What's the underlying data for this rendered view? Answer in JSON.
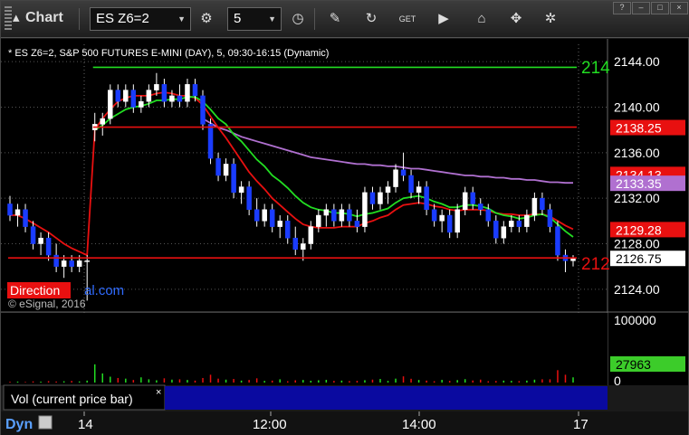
{
  "window": {
    "title": "Chart",
    "controls": [
      "?",
      "–",
      "□",
      "×"
    ]
  },
  "toolbar": {
    "symbol": "ES Z6=2",
    "interval": "5",
    "icons": [
      "gear-icon",
      "clock-icon",
      "pencil-icon",
      "refresh-icon",
      "get-icon",
      "play-icon",
      "tag-icon",
      "link-icon",
      "settings-icon"
    ]
  },
  "chart": {
    "header": "* ES Z6=2, S&P 500 FUTURES E-MINI (DAY), 5, 09:30-16:15 (Dynamic)",
    "watermark": "© eSignal, 2016",
    "direction_label": "Direction",
    "direction_suffix": "al.com",
    "hline_label_1": "214",
    "hline_label_2": "212",
    "price_ticks": [
      "2144.00",
      "2140.00",
      "2136.00",
      "2132.00",
      "2128.00",
      "2124.00"
    ],
    "price_badges": [
      {
        "text": "2138.25",
        "bg": "#e81010",
        "fg": "#fff"
      },
      {
        "text": "2134.13",
        "bg": "#e81010",
        "fg": "#fff"
      },
      {
        "text": "2133.35",
        "bg": "#b070d0",
        "fg": "#fff"
      },
      {
        "text": "2129.28",
        "bg": "#e81010",
        "fg": "#fff"
      },
      {
        "text": "2126.75",
        "bg": "#fff",
        "fg": "#000"
      }
    ]
  },
  "volume": {
    "label": "Vol (current price bar)",
    "close_label": "×",
    "ticks": [
      "100000",
      "0"
    ],
    "badge": "27963",
    "badge_color": "#3ccc2a"
  },
  "time_axis": {
    "labels": [
      "14",
      "12:00",
      "14:00",
      "17"
    ],
    "dyn": "Dyn",
    "footer_icon": "lock-icon"
  },
  "chart_data": {
    "type": "candlestick",
    "title": "* ES Z6=2, S&P 500 FUTURES E-MINI (DAY), 5, 09:30-16:15 (Dynamic)",
    "y_range": [
      2122.0,
      2146.0
    ],
    "candles": [
      {
        "o": 2131.5,
        "h": 2132.2,
        "l": 2130.0,
        "c": 2130.5
      },
      {
        "o": 2130.5,
        "h": 2131.5,
        "l": 2129.5,
        "c": 2131.0
      },
      {
        "o": 2131.0,
        "h": 2131.5,
        "l": 2129.0,
        "c": 2129.5
      },
      {
        "o": 2129.5,
        "h": 2130.0,
        "l": 2127.5,
        "c": 2128.0
      },
      {
        "o": 2128.0,
        "h": 2129.0,
        "l": 2127.0,
        "c": 2128.5
      },
      {
        "o": 2128.5,
        "h": 2129.0,
        "l": 2126.5,
        "c": 2127.0
      },
      {
        "o": 2127.0,
        "h": 2128.0,
        "l": 2125.5,
        "c": 2126.0
      },
      {
        "o": 2126.0,
        "h": 2127.0,
        "l": 2125.0,
        "c": 2126.5
      },
      {
        "o": 2126.5,
        "h": 2127.0,
        "l": 2125.5,
        "c": 2126.0
      },
      {
        "o": 2126.0,
        "h": 2127.0,
        "l": 2125.5,
        "c": 2126.5
      },
      {
        "o": 2126.5,
        "h": 2127.0,
        "l": 2123.0,
        "c": 2126.5
      },
      {
        "o": 2138.0,
        "h": 2139.5,
        "l": 2137.0,
        "c": 2138.5
      },
      {
        "o": 2138.5,
        "h": 2139.5,
        "l": 2137.5,
        "c": 2139.0
      },
      {
        "o": 2139.0,
        "h": 2142.0,
        "l": 2138.5,
        "c": 2141.5
      },
      {
        "o": 2141.5,
        "h": 2142.0,
        "l": 2140.0,
        "c": 2140.5
      },
      {
        "o": 2140.5,
        "h": 2142.0,
        "l": 2140.0,
        "c": 2141.5
      },
      {
        "o": 2141.5,
        "h": 2142.0,
        "l": 2139.5,
        "c": 2140.0
      },
      {
        "o": 2140.0,
        "h": 2141.0,
        "l": 2139.5,
        "c": 2140.5
      },
      {
        "o": 2140.5,
        "h": 2142.0,
        "l": 2140.0,
        "c": 2141.5
      },
      {
        "o": 2141.5,
        "h": 2143.0,
        "l": 2141.0,
        "c": 2142.0
      },
      {
        "o": 2142.0,
        "h": 2142.5,
        "l": 2140.0,
        "c": 2140.5
      },
      {
        "o": 2140.5,
        "h": 2141.5,
        "l": 2140.0,
        "c": 2141.0
      },
      {
        "o": 2141.0,
        "h": 2142.0,
        "l": 2140.0,
        "c": 2140.5
      },
      {
        "o": 2140.5,
        "h": 2142.5,
        "l": 2140.0,
        "c": 2142.0
      },
      {
        "o": 2142.0,
        "h": 2142.5,
        "l": 2140.5,
        "c": 2141.0
      },
      {
        "o": 2141.0,
        "h": 2141.5,
        "l": 2138.0,
        "c": 2138.5
      },
      {
        "o": 2138.5,
        "h": 2139.0,
        "l": 2135.0,
        "c": 2135.5
      },
      {
        "o": 2135.5,
        "h": 2136.0,
        "l": 2133.5,
        "c": 2134.0
      },
      {
        "o": 2134.0,
        "h": 2135.5,
        "l": 2133.5,
        "c": 2135.0
      },
      {
        "o": 2135.0,
        "h": 2135.5,
        "l": 2132.0,
        "c": 2132.5
      },
      {
        "o": 2132.5,
        "h": 2133.5,
        "l": 2131.5,
        "c": 2133.0
      },
      {
        "o": 2133.0,
        "h": 2133.5,
        "l": 2130.5,
        "c": 2131.0
      },
      {
        "o": 2131.0,
        "h": 2132.0,
        "l": 2129.5,
        "c": 2130.0
      },
      {
        "o": 2130.0,
        "h": 2131.5,
        "l": 2129.5,
        "c": 2131.0
      },
      {
        "o": 2131.0,
        "h": 2131.5,
        "l": 2129.0,
        "c": 2129.5
      },
      {
        "o": 2129.5,
        "h": 2130.5,
        "l": 2128.5,
        "c": 2130.0
      },
      {
        "o": 2130.0,
        "h": 2130.5,
        "l": 2128.0,
        "c": 2128.5
      },
      {
        "o": 2128.5,
        "h": 2129.5,
        "l": 2127.0,
        "c": 2127.5
      },
      {
        "o": 2127.5,
        "h": 2128.5,
        "l": 2126.5,
        "c": 2128.0
      },
      {
        "o": 2128.0,
        "h": 2130.0,
        "l": 2127.5,
        "c": 2129.5
      },
      {
        "o": 2129.5,
        "h": 2131.0,
        "l": 2129.0,
        "c": 2130.5
      },
      {
        "o": 2130.5,
        "h": 2131.5,
        "l": 2129.5,
        "c": 2131.0
      },
      {
        "o": 2131.0,
        "h": 2131.5,
        "l": 2129.5,
        "c": 2130.0
      },
      {
        "o": 2130.0,
        "h": 2131.5,
        "l": 2129.5,
        "c": 2131.0
      },
      {
        "o": 2131.0,
        "h": 2131.5,
        "l": 2129.5,
        "c": 2130.0
      },
      {
        "o": 2130.0,
        "h": 2131.0,
        "l": 2129.0,
        "c": 2129.5
      },
      {
        "o": 2129.5,
        "h": 2133.0,
        "l": 2129.0,
        "c": 2132.5
      },
      {
        "o": 2132.5,
        "h": 2133.0,
        "l": 2131.0,
        "c": 2131.5
      },
      {
        "o": 2131.5,
        "h": 2133.0,
        "l": 2131.0,
        "c": 2132.5
      },
      {
        "o": 2132.5,
        "h": 2133.5,
        "l": 2131.5,
        "c": 2133.0
      },
      {
        "o": 2133.0,
        "h": 2135.0,
        "l": 2132.5,
        "c": 2134.5
      },
      {
        "o": 2134.5,
        "h": 2136.0,
        "l": 2133.5,
        "c": 2134.0
      },
      {
        "o": 2134.0,
        "h": 2134.5,
        "l": 2132.0,
        "c": 2132.5
      },
      {
        "o": 2132.5,
        "h": 2133.5,
        "l": 2131.5,
        "c": 2133.0
      },
      {
        "o": 2133.0,
        "h": 2133.5,
        "l": 2130.5,
        "c": 2131.0
      },
      {
        "o": 2131.0,
        "h": 2131.5,
        "l": 2129.5,
        "c": 2130.0
      },
      {
        "o": 2130.0,
        "h": 2131.0,
        "l": 2129.0,
        "c": 2130.5
      },
      {
        "o": 2130.5,
        "h": 2131.0,
        "l": 2128.5,
        "c": 2129.0
      },
      {
        "o": 2129.0,
        "h": 2131.5,
        "l": 2128.5,
        "c": 2131.0
      },
      {
        "o": 2131.0,
        "h": 2133.0,
        "l": 2130.5,
        "c": 2132.5
      },
      {
        "o": 2132.5,
        "h": 2133.0,
        "l": 2131.0,
        "c": 2131.5
      },
      {
        "o": 2131.5,
        "h": 2132.0,
        "l": 2130.5,
        "c": 2131.0
      },
      {
        "o": 2131.0,
        "h": 2131.5,
        "l": 2129.5,
        "c": 2130.0
      },
      {
        "o": 2130.0,
        "h": 2130.5,
        "l": 2128.0,
        "c": 2128.5
      },
      {
        "o": 2128.5,
        "h": 2130.0,
        "l": 2128.0,
        "c": 2129.5
      },
      {
        "o": 2129.5,
        "h": 2130.5,
        "l": 2129.0,
        "c": 2130.0
      },
      {
        "o": 2130.0,
        "h": 2130.5,
        "l": 2129.0,
        "c": 2129.5
      },
      {
        "o": 2129.5,
        "h": 2131.0,
        "l": 2129.0,
        "c": 2130.5
      },
      {
        "o": 2130.5,
        "h": 2132.5,
        "l": 2130.0,
        "c": 2132.0
      },
      {
        "o": 2132.0,
        "h": 2132.5,
        "l": 2130.5,
        "c": 2131.0
      },
      {
        "o": 2131.0,
        "h": 2131.5,
        "l": 2129.0,
        "c": 2129.5
      },
      {
        "o": 2129.5,
        "h": 2130.0,
        "l": 2126.5,
        "c": 2127.0
      },
      {
        "o": 2127.0,
        "h": 2127.5,
        "l": 2125.5,
        "c": 2126.5
      },
      {
        "o": 2126.5,
        "h": 2127.0,
        "l": 2126.0,
        "c": 2126.75
      }
    ],
    "ema_red": [
      2130.5,
      2130.5,
      2130.2,
      2129.8,
      2129.4,
      2129.0,
      2128.5,
      2128.0,
      2127.6,
      2127.3,
      2127.0,
      2138.0,
      2139.0,
      2139.8,
      2140.5,
      2140.8,
      2141.0,
      2141.0,
      2141.0,
      2141.2,
      2141.3,
      2141.2,
      2141.0,
      2141.0,
      2140.8,
      2140.2,
      2139.2,
      2138.2,
      2137.3,
      2136.3,
      2135.3,
      2134.3,
      2133.5,
      2132.8,
      2132.0,
      2131.4,
      2130.8,
      2130.2,
      2129.7,
      2129.5,
      2129.4,
      2129.4,
      2129.4,
      2129.5,
      2129.5,
      2129.5,
      2129.8,
      2130.0,
      2130.3,
      2130.5,
      2131.0,
      2131.4,
      2131.5,
      2131.6,
      2131.5,
      2131.3,
      2131.2,
      2131.0,
      2130.9,
      2131.0,
      2131.0,
      2131.0,
      2130.9,
      2130.7,
      2130.6,
      2130.6,
      2130.5,
      2130.5,
      2130.6,
      2130.6,
      2130.4,
      2130.0,
      2129.6,
      2129.28
    ],
    "ema_green": [
      null,
      null,
      null,
      null,
      null,
      null,
      null,
      null,
      null,
      null,
      null,
      2138.0,
      2138.4,
      2139.0,
      2139.4,
      2139.8,
      2140.0,
      2140.1,
      2140.3,
      2140.6,
      2140.6,
      2140.7,
      2140.7,
      2140.9,
      2140.9,
      2140.5,
      2139.8,
      2139.0,
      2138.5,
      2137.6,
      2137.0,
      2136.2,
      2135.4,
      2134.8,
      2134.0,
      2133.5,
      2132.9,
      2132.2,
      2131.6,
      2131.2,
      2131.0,
      2130.9,
      2130.7,
      2130.7,
      2130.6,
      2130.4,
      2130.6,
      2130.7,
      2130.9,
      2131.1,
      2131.6,
      2132.0,
      2132.1,
      2132.2,
      2132.0,
      2131.7,
      2131.5,
      2131.2,
      2131.2,
      2131.4,
      2131.4,
      2131.3,
      2131.1,
      2130.7,
      2130.5,
      2130.4,
      2130.2,
      2130.3,
      2130.5,
      2130.6,
      2130.3,
      2129.7,
      2129.1,
      2128.6
    ],
    "vwap_purple": [
      null,
      null,
      null,
      null,
      null,
      null,
      null,
      null,
      null,
      null,
      null,
      null,
      null,
      null,
      null,
      null,
      null,
      null,
      null,
      null,
      null,
      null,
      null,
      null,
      null,
      2139.0,
      2138.6,
      2138.2,
      2138.0,
      2137.7,
      2137.4,
      2137.2,
      2137.0,
      2136.8,
      2136.6,
      2136.4,
      2136.2,
      2136.0,
      2135.8,
      2135.6,
      2135.5,
      2135.4,
      2135.3,
      2135.2,
      2135.1,
      2135.0,
      2135.0,
      2134.9,
      2134.9,
      2134.8,
      2134.8,
      2134.7,
      2134.6,
      2134.6,
      2134.5,
      2134.4,
      2134.3,
      2134.2,
      2134.1,
      2134.0,
      2134.0,
      2133.9,
      2133.9,
      2133.8,
      2133.8,
      2133.7,
      2133.7,
      2133.6,
      2133.6,
      2133.5,
      2133.4,
      2133.4,
      2133.35,
      2133.35
    ],
    "hlines": [
      {
        "value": 2143.5,
        "color": "#22dd22",
        "from": 11
      },
      {
        "value": 2138.25,
        "color": "#e81010",
        "from": 11
      },
      {
        "value": 2126.75,
        "color": "#e81010",
        "from": 0
      }
    ],
    "volume": [
      1200,
      1500,
      900,
      1800,
      1400,
      2200,
      1600,
      2000,
      2500,
      1700,
      3000,
      28000,
      14000,
      9000,
      7000,
      6000,
      4000,
      8000,
      5000,
      3500,
      6500,
      4500,
      5000,
      4000,
      3000,
      7000,
      12000,
      6000,
      4500,
      5500,
      3000,
      4000,
      6500,
      2500,
      3000,
      5000,
      2000,
      3500,
      4000,
      2800,
      3500,
      4200,
      2500,
      3000,
      2200,
      2600,
      3600,
      4500,
      5500,
      2500,
      6000,
      9500,
      5800,
      4000,
      3000,
      2000,
      4200,
      2500,
      3800,
      5200,
      3200,
      4500,
      2000,
      2400,
      3000,
      2600,
      2200,
      3000,
      4400,
      5000,
      5000,
      19000,
      12000,
      8000
    ]
  }
}
